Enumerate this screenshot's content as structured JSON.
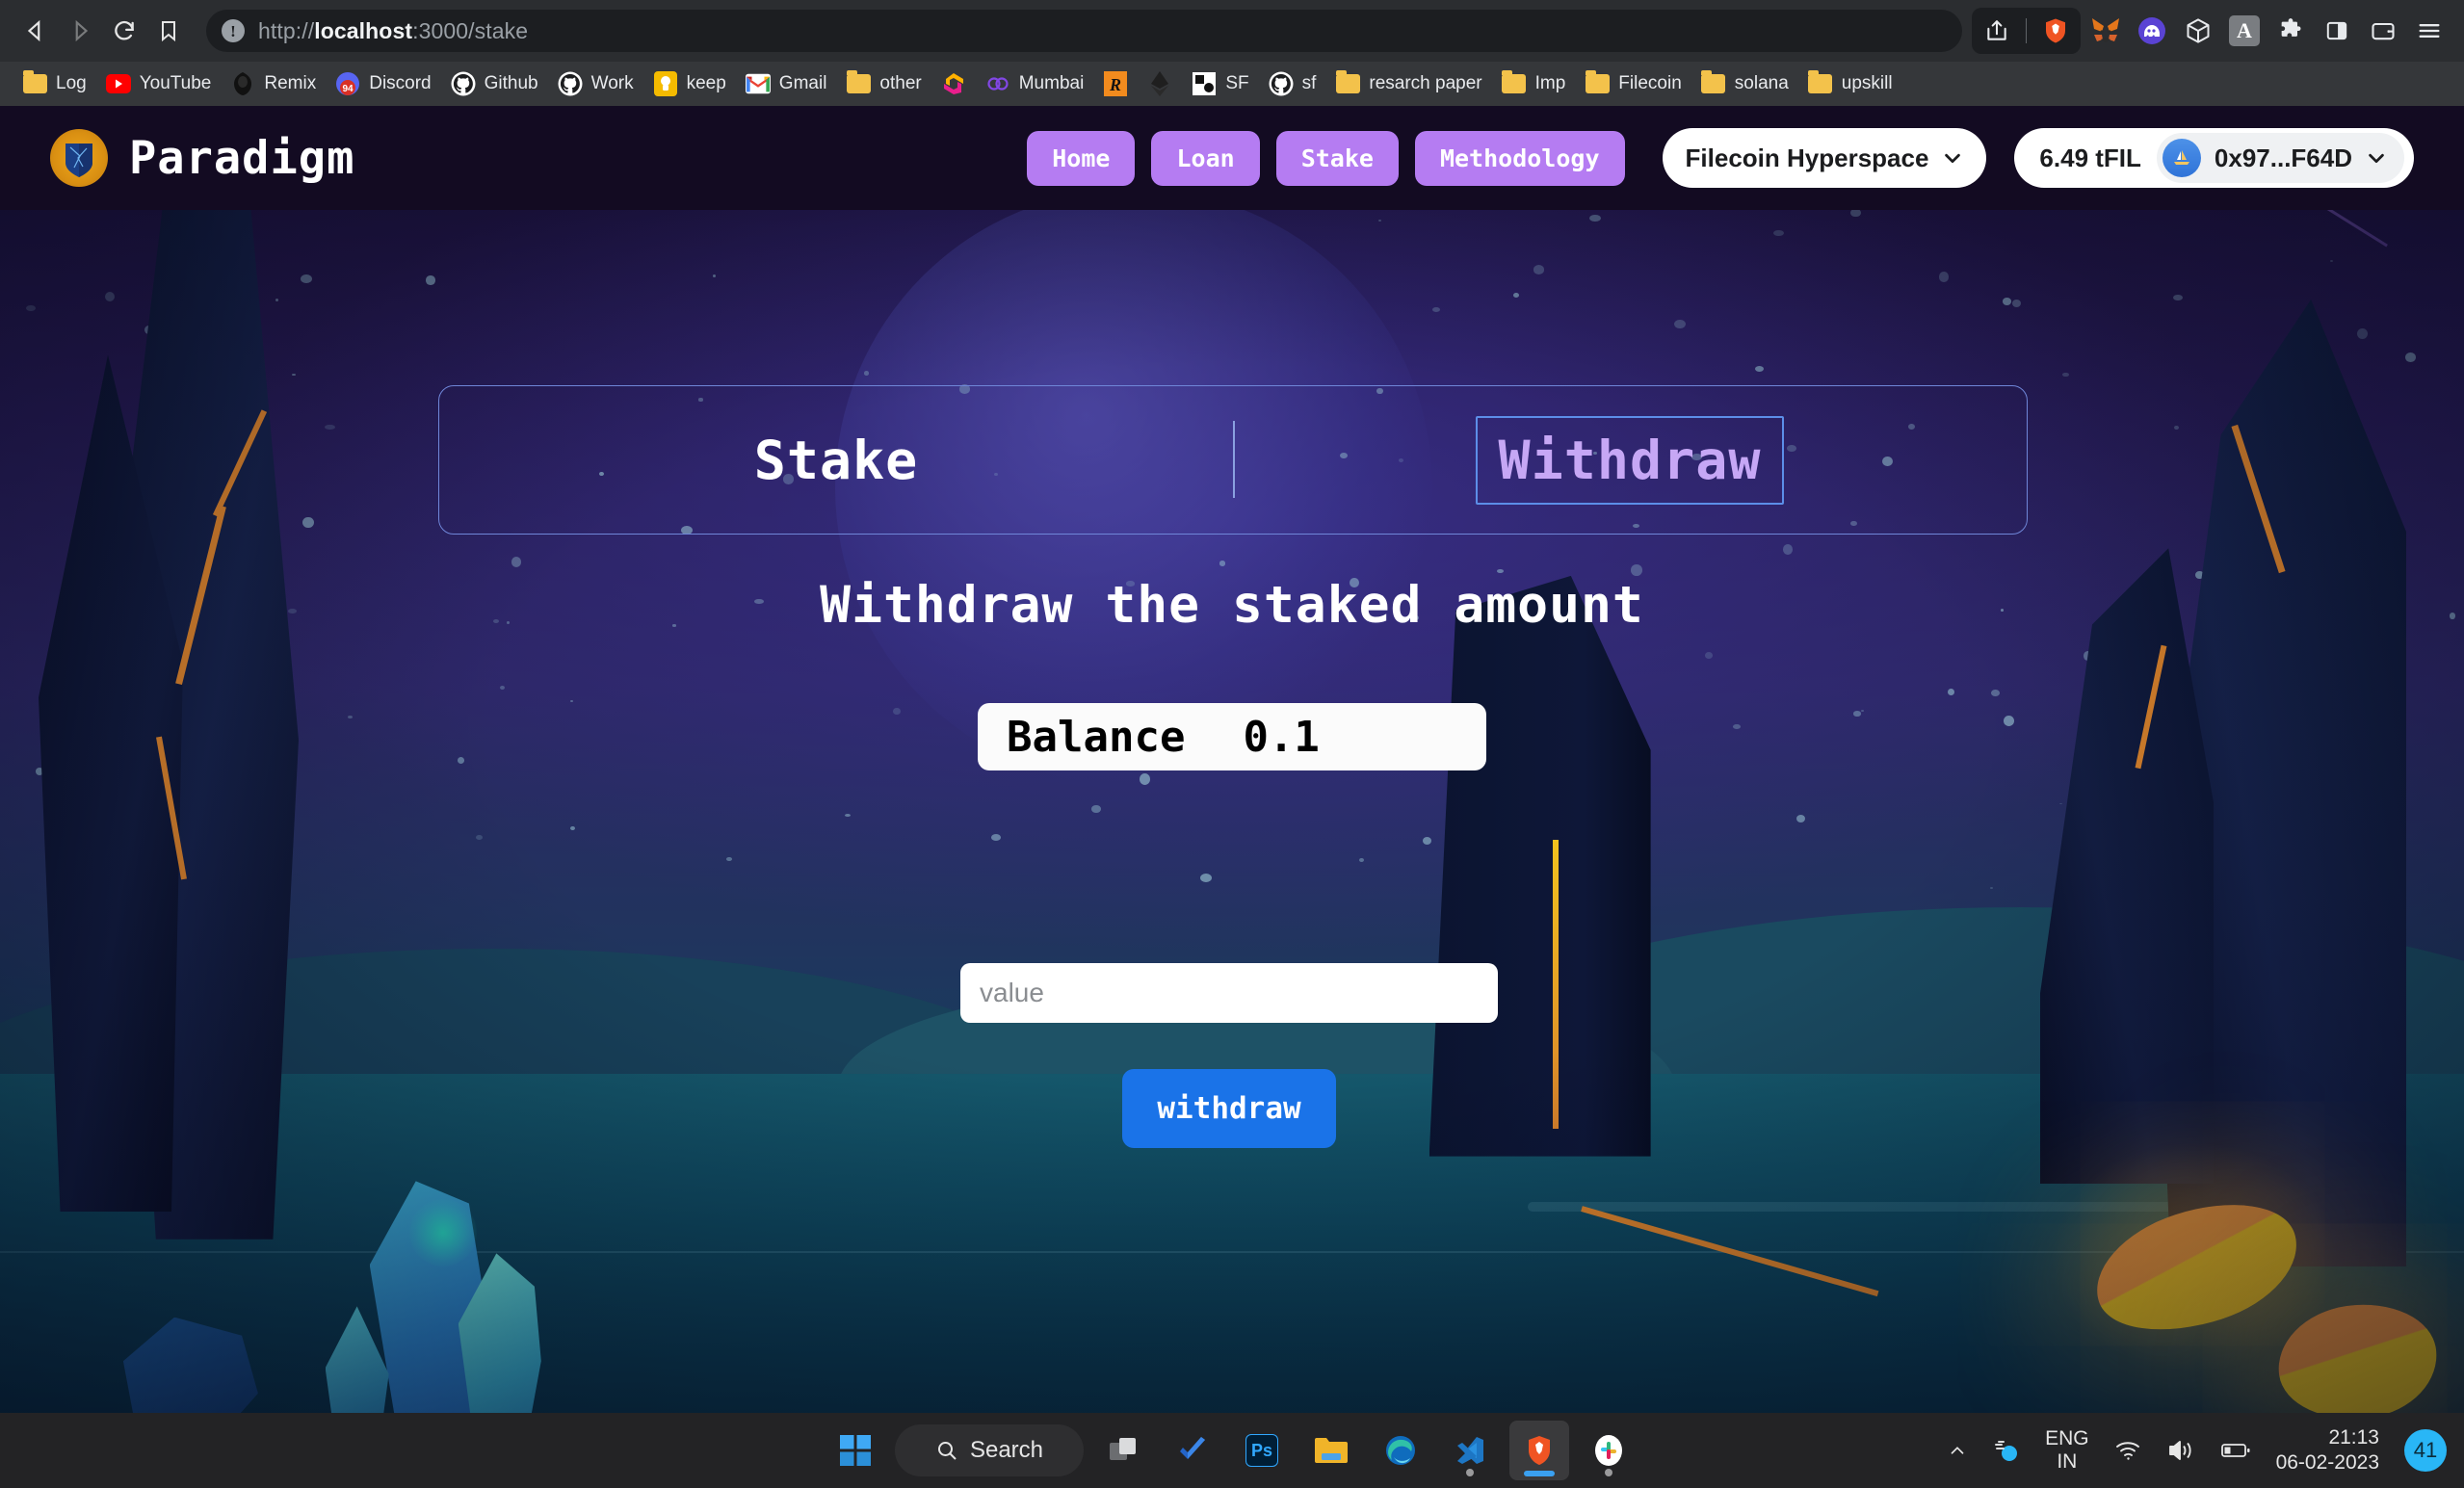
{
  "browser": {
    "url_prefix": "http://",
    "url_host": "localhost",
    "url_suffix": ":3000/stake",
    "nav": {
      "back": "back-button",
      "forward": "forward-button",
      "reload": "reload-button",
      "bookmark": "bookmark-button"
    },
    "toolbar_icons": [
      "share-icon",
      "brave-shields-icon",
      "metamask-icon",
      "phantom-icon",
      "cube-icon",
      "grammarly-icon",
      "extensions-icon",
      "sidebar-icon",
      "wallet-icon",
      "menu-icon"
    ],
    "bookmarks": [
      {
        "label": "Log",
        "icon": "folder-icon"
      },
      {
        "label": "YouTube",
        "icon": "youtube-icon"
      },
      {
        "label": "Remix",
        "icon": "remix-icon"
      },
      {
        "label": "Discord",
        "icon": "discord-icon",
        "badge": "94"
      },
      {
        "label": "Github",
        "icon": "github-icon"
      },
      {
        "label": "Work",
        "icon": "github-icon"
      },
      {
        "label": "keep",
        "icon": "google-keep-icon"
      },
      {
        "label": "Gmail",
        "icon": "gmail-icon"
      },
      {
        "label": "other",
        "icon": "folder-icon"
      },
      {
        "label": "",
        "icon": "polygon-icon"
      },
      {
        "label": "Mumbai",
        "icon": "chain-link-icon"
      },
      {
        "label": "",
        "icon": "remix-r-icon"
      },
      {
        "label": "",
        "icon": "ethereum-icon"
      },
      {
        "label": "SF",
        "icon": "superfluid-icon"
      },
      {
        "label": "sf",
        "icon": "github-icon"
      },
      {
        "label": "resarch paper",
        "icon": "folder-icon"
      },
      {
        "label": "Imp",
        "icon": "folder-icon"
      },
      {
        "label": "Filecoin",
        "icon": "folder-icon"
      },
      {
        "label": "solana",
        "icon": "folder-icon"
      },
      {
        "label": "upskill",
        "icon": "folder-icon"
      }
    ]
  },
  "app": {
    "brand": "Paradigm",
    "nav_items": [
      {
        "label": "Home"
      },
      {
        "label": "Loan"
      },
      {
        "label": "Stake"
      },
      {
        "label": "Methodology"
      }
    ],
    "network": "Filecoin Hyperspace",
    "balance": "6.49 tFIL",
    "address": "0x97...F64D",
    "accent_purple": "#b57cf2",
    "accent_blue": "#1a73e8"
  },
  "main": {
    "tabs": [
      {
        "label": "Stake",
        "active": false
      },
      {
        "label": "Withdraw",
        "active": true
      }
    ],
    "headline": "Withdraw the staked amount",
    "balance_label": "Balance",
    "balance_value": "0.1",
    "input_placeholder": "value",
    "input_value": "",
    "submit_label": "withdraw"
  },
  "taskbar": {
    "search_label": "Search",
    "items": [
      {
        "name": "start-button"
      },
      {
        "name": "search-box"
      },
      {
        "name": "task-view-button"
      },
      {
        "name": "todo-app"
      },
      {
        "name": "photoshop-app"
      },
      {
        "name": "file-explorer-app"
      },
      {
        "name": "microsoft-edge-app"
      },
      {
        "name": "vscode-app"
      },
      {
        "name": "brave-browser-app"
      },
      {
        "name": "slack-app"
      }
    ],
    "tray": {
      "language": "ENG",
      "region": "IN",
      "time": "21:13",
      "date": "06-02-2023",
      "badge": "41"
    }
  }
}
